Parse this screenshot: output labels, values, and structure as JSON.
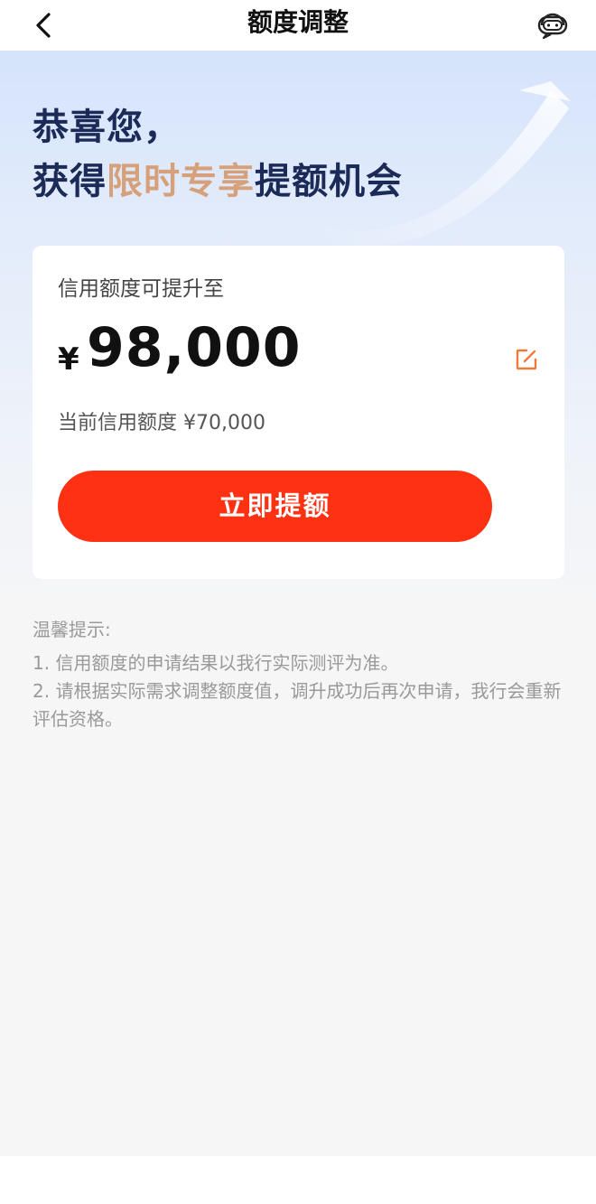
{
  "nav": {
    "back_icon": "chevron-left-icon",
    "title": "额度调整",
    "service_icon": "customer-service-robot-icon"
  },
  "hero": {
    "line1": "恭喜您，",
    "line2_prefix": "获得",
    "line2_highlight": "限时专享",
    "line2_suffix": "提额机会"
  },
  "card": {
    "label": "信用额度可提升至",
    "currency": "¥",
    "amount": "98,000",
    "edit_icon": "edit-icon",
    "current_limit": "当前信用额度 ¥70,000",
    "button_label": "立即提额"
  },
  "tips": {
    "title": "温馨提示:",
    "items": [
      "1. 信用额度的申请结果以我行实际测评为准。",
      "2. 请根据实际需求调整额度值，调升成功后再次申请，我行会重新评估资格。"
    ]
  },
  "colors": {
    "accent": "#fe3212",
    "highlight": "#d6a17a",
    "heading": "#1c2a58",
    "edit_icon": "#f07a3c"
  }
}
